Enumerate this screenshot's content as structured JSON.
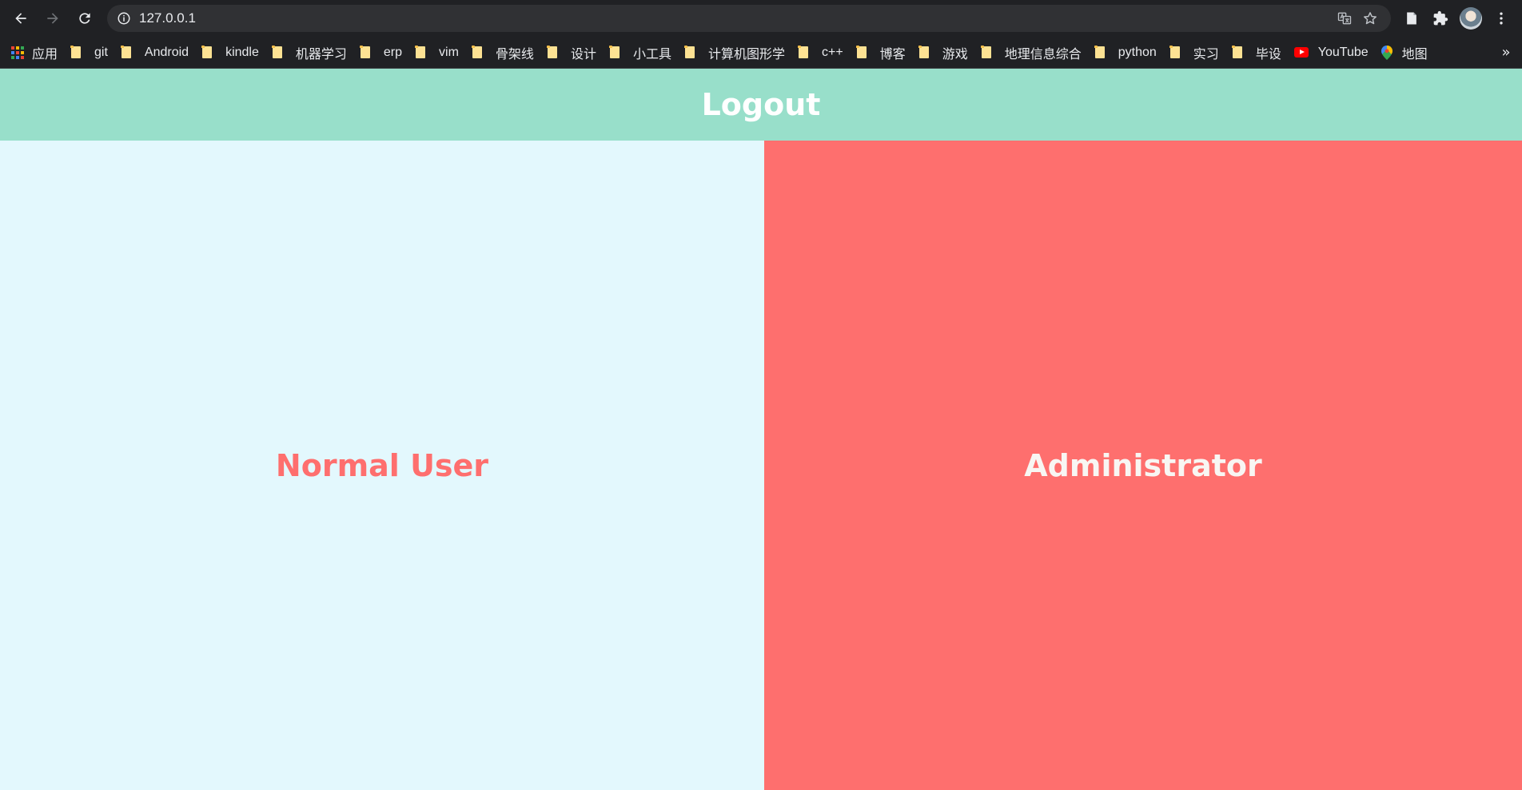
{
  "browser": {
    "url": "127.0.0.1",
    "bookmarks": [
      {
        "label": "应用",
        "icon": "apps-icon"
      },
      {
        "label": "git",
        "icon": "folder-icon"
      },
      {
        "label": "Android",
        "icon": "folder-icon"
      },
      {
        "label": "kindle",
        "icon": "folder-icon"
      },
      {
        "label": "机器学习",
        "icon": "folder-icon"
      },
      {
        "label": "erp",
        "icon": "folder-icon"
      },
      {
        "label": "vim",
        "icon": "folder-icon"
      },
      {
        "label": "骨架线",
        "icon": "folder-icon"
      },
      {
        "label": "设计",
        "icon": "folder-icon"
      },
      {
        "label": "小工具",
        "icon": "folder-icon"
      },
      {
        "label": "计算机图形学",
        "icon": "folder-icon"
      },
      {
        "label": "c++",
        "icon": "folder-icon"
      },
      {
        "label": "博客",
        "icon": "folder-icon"
      },
      {
        "label": "游戏",
        "icon": "folder-icon"
      },
      {
        "label": "地理信息综合",
        "icon": "folder-icon"
      },
      {
        "label": "python",
        "icon": "folder-icon"
      },
      {
        "label": "实习",
        "icon": "folder-icon"
      },
      {
        "label": "毕设",
        "icon": "folder-icon"
      },
      {
        "label": "YouTube",
        "icon": "youtube-icon"
      },
      {
        "label": "地图",
        "icon": "map-pin-icon"
      }
    ],
    "more_bookmarks": "»"
  },
  "page": {
    "header": {
      "logout_label": "Logout",
      "color": "#98dfca"
    },
    "panels": {
      "normal_user": {
        "label": "Normal User",
        "background": "#e3f8fd",
        "text_color": "#fe6f6e"
      },
      "administrator": {
        "label": "Administrator",
        "background": "#fe6f6e",
        "text_color": "#f8f6f3"
      }
    }
  }
}
